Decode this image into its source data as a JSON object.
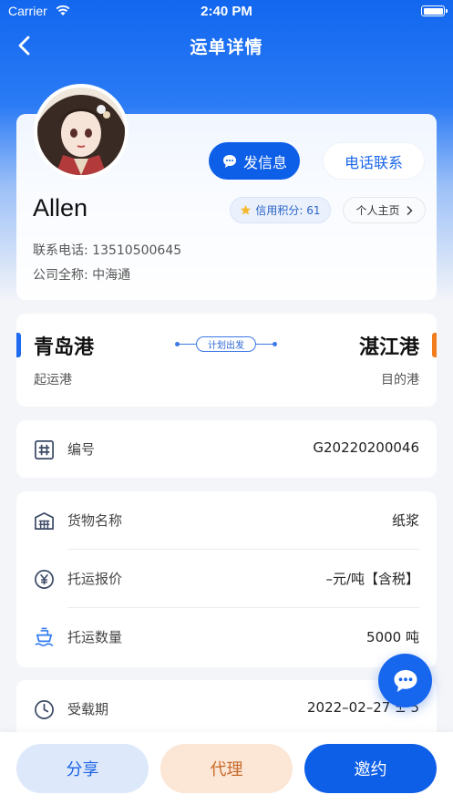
{
  "status_bar": {
    "carrier": "Carrier",
    "time": "2:40 PM"
  },
  "nav": {
    "title": "运单详情"
  },
  "profile": {
    "name": "Allen",
    "send_message_label": "发信息",
    "call_label": "电话联系",
    "credit_label": "信用积分: 61",
    "homepage_label": "个人主页",
    "phone_line": "联系电话: 13510500645",
    "company_line": "公司全称: 中海通"
  },
  "route": {
    "from_port": "青岛港",
    "to_port": "湛江港",
    "from_label": "起运港",
    "to_label": "目的港",
    "status_tag": "计划出发"
  },
  "waybill": {
    "id_label": "编号",
    "id_value": "G20220200046"
  },
  "goods": {
    "name_label": "货物名称",
    "name_value": "纸浆",
    "price_label": "托运报价",
    "price_value": "–元/吨【含税】",
    "quantity_label": "托运数量",
    "quantity_value": "5000 吨"
  },
  "period": {
    "label": "受载期",
    "value": "2022–02–27 ± 5"
  },
  "bottom": {
    "share_label": "分享",
    "agent_label": "代理",
    "invite_label": "邀约"
  },
  "colors": {
    "primary": "#0e5fe8",
    "accent_orange": "#f27c1e",
    "background": "#f3f5f9"
  }
}
